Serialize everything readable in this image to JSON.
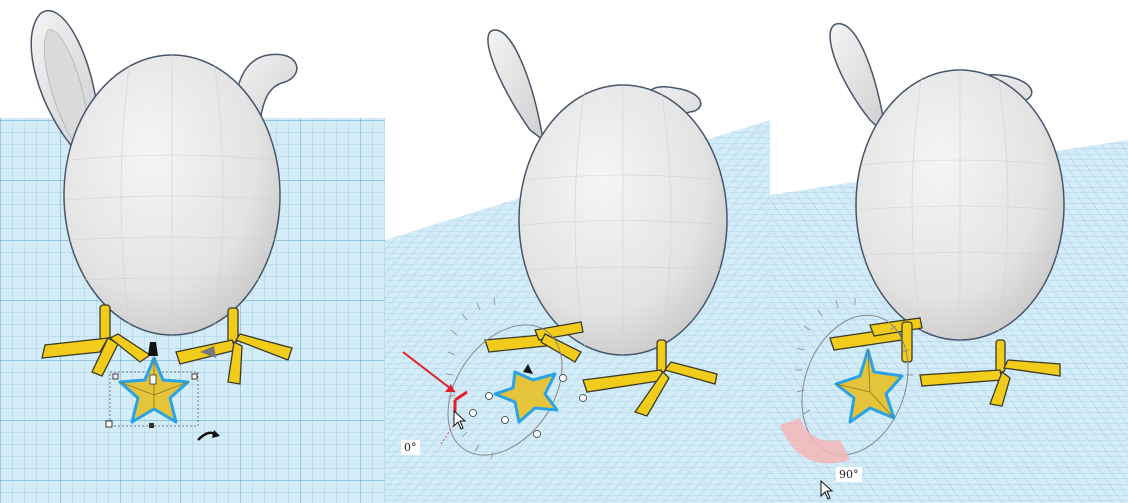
{
  "scene": {
    "panels": [
      {
        "id": "panel-1",
        "state": "star-selected"
      },
      {
        "id": "panel-2",
        "state": "rotate-handle-grabbed"
      },
      {
        "id": "panel-3",
        "state": "rotated-90"
      }
    ]
  },
  "rotation": {
    "start_label": "0°",
    "end_label": "90°"
  },
  "colors": {
    "grid_bg": "#d3ebf7",
    "grid_line": "#8ec4df",
    "egg_fill": "#e9e9e9",
    "feet_fill": "#f2cc1a",
    "star_fill": "#e5c33a",
    "selection": "#2aa3e6",
    "arrow": "#e2202a",
    "arc_fill": "#f3b6b6"
  },
  "icons": [
    "rotate-handle-icon",
    "lift-cone-icon",
    "mouse-cursor-icon"
  ]
}
